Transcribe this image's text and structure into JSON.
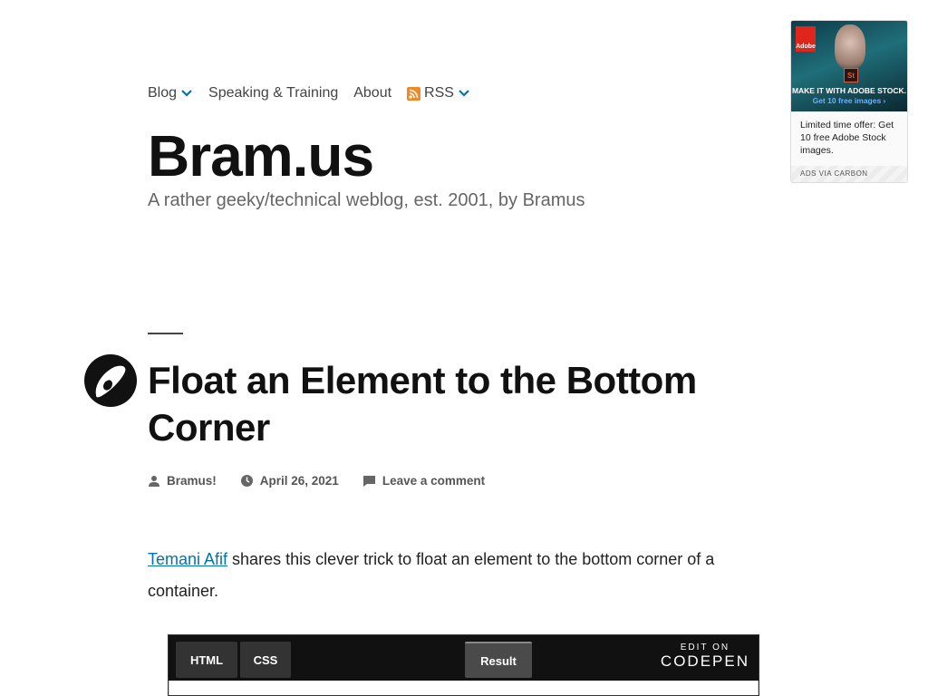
{
  "nav": {
    "items": [
      {
        "label": "Blog",
        "has_dropdown": true
      },
      {
        "label": "Speaking & Training",
        "has_dropdown": false
      },
      {
        "label": "About",
        "has_dropdown": false
      },
      {
        "label": "RSS",
        "has_dropdown": true,
        "icon": "rss-icon"
      }
    ]
  },
  "site": {
    "title": "Bram.us",
    "description": "A rather geeky/technical weblog, est. 2001, by Bramus"
  },
  "ad": {
    "brand": "Adobe",
    "product_badge": "St",
    "headline": "MAKE IT WITH ADOBE STOCK.",
    "cta": "Get 10 free images ›",
    "text": "Limited time offer: Get 10 free Adobe Stock images.",
    "via": "ADS VIA CARBON"
  },
  "post": {
    "title": "Float an Element to the Bottom Corner",
    "author": "Bramus!",
    "date": "April 26, 2021",
    "comments": "Leave a comment",
    "intro_link": "Temani Afif",
    "intro_rest": " shares this clever trick to float an element to the bottom corner of a container."
  },
  "codepen": {
    "tabs": [
      "HTML",
      "CSS"
    ],
    "result": "Result",
    "edit_on": "EDIT ON",
    "brand": "CODEPEN"
  },
  "colors": {
    "link": "#0073aa",
    "rss": "#f08a24",
    "text": "#111111"
  }
}
